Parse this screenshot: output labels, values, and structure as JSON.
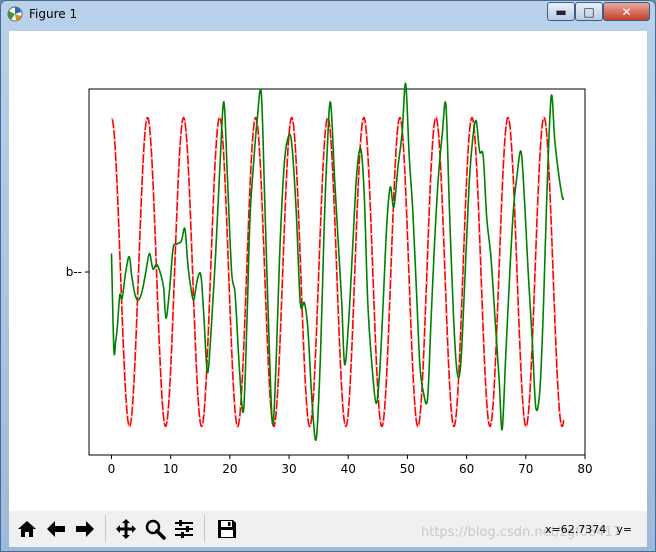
{
  "window": {
    "title": "Figure 1",
    "min_glyph": "▬",
    "max_glyph": "□",
    "close_glyph": "✕"
  },
  "toolbar": {
    "buttons": [
      {
        "name": "home",
        "icon": "home-icon"
      },
      {
        "name": "back",
        "icon": "arrow-left-icon"
      },
      {
        "name": "forward",
        "icon": "arrow-right-icon"
      },
      {
        "name": "pan",
        "icon": "move-icon"
      },
      {
        "name": "zoom",
        "icon": "magnifier-icon"
      },
      {
        "name": "subplots",
        "icon": "sliders-icon"
      },
      {
        "name": "save",
        "icon": "floppy-icon"
      }
    ],
    "coords_x": "x=62.7374",
    "coords_y": "y=",
    "watermark": "https://blog.csdn.net/zgf06417"
  },
  "chart_data": {
    "type": "line",
    "xlim": [
      -3.8,
      80
    ],
    "ylim": [
      -1.185,
      1.185
    ],
    "xticks": [
      0,
      10,
      20,
      30,
      40,
      50,
      60,
      70,
      80
    ],
    "ytick_label": "b--",
    "ytick_value": 0,
    "grid": false,
    "colors": {
      "sine": "#ff0000",
      "predicted": "#008000",
      "dashes": "#ffffff"
    },
    "series": [
      {
        "color": "red",
        "style": "cosine, dashed white overlay",
        "x_start": 0,
        "x_end": 76.4,
        "amplitude": 1.0,
        "period": 6.09
      },
      {
        "color": "green",
        "style": "solid",
        "points": [
          [
            0,
            0.12
          ],
          [
            0.4,
            -0.5
          ],
          [
            0.7,
            -0.45
          ],
          [
            1,
            -0.35
          ],
          [
            1.4,
            -0.15
          ],
          [
            1.8,
            -0.17
          ],
          [
            2.4,
            0.0
          ],
          [
            3,
            0.1
          ],
          [
            3.4,
            -0.02
          ],
          [
            4,
            -0.15
          ],
          [
            4.6,
            -0.18
          ],
          [
            5.2,
            -0.12
          ],
          [
            5.8,
            0.0
          ],
          [
            6.4,
            0.12
          ],
          [
            7,
            0.02
          ],
          [
            7.6,
            0.05
          ],
          [
            8.2,
            0.0
          ],
          [
            8.8,
            -0.1
          ],
          [
            9.2,
            -0.3
          ],
          [
            9.8,
            -0.12
          ],
          [
            10.4,
            0.15
          ],
          [
            11,
            0.18
          ],
          [
            11.8,
            0.2
          ],
          [
            12.4,
            0.28
          ],
          [
            12.9,
            0.05
          ],
          [
            13.4,
            -0.1
          ],
          [
            13.9,
            -0.18
          ],
          [
            14.5,
            -0.05
          ],
          [
            15.1,
            -0.02
          ],
          [
            15.6,
            -0.28
          ],
          [
            16.2,
            -0.65
          ],
          [
            16.8,
            -0.4
          ],
          [
            17.6,
            0.12
          ],
          [
            18.4,
            0.75
          ],
          [
            19,
            1.1
          ],
          [
            19.6,
            0.6
          ],
          [
            20.3,
            0.0
          ],
          [
            20.9,
            -0.15
          ],
          [
            21.6,
            -0.62
          ],
          [
            22.3,
            -0.9
          ],
          [
            22.9,
            -0.3
          ],
          [
            23.4,
            0.35
          ],
          [
            24,
            0.7
          ],
          [
            24.6,
            0.98
          ],
          [
            25.3,
            1.16
          ],
          [
            25.9,
            0.45
          ],
          [
            26.5,
            -0.3
          ],
          [
            27.2,
            -0.98
          ],
          [
            27.8,
            -0.6
          ],
          [
            28.4,
            0.1
          ],
          [
            29.1,
            0.65
          ],
          [
            29.7,
            0.85
          ],
          [
            30.4,
            0.85
          ],
          [
            31.2,
            0.4
          ],
          [
            31.9,
            -0.2
          ],
          [
            32.6,
            -0.2
          ],
          [
            33.2,
            -0.38
          ],
          [
            33.9,
            -0.85
          ],
          [
            34.6,
            -1.08
          ],
          [
            35.3,
            -0.55
          ],
          [
            35.9,
            0.25
          ],
          [
            36.4,
            0.75
          ],
          [
            37,
            1.1
          ],
          [
            37.7,
            0.6
          ],
          [
            38.3,
            0.2
          ],
          [
            38.9,
            -0.2
          ],
          [
            39.4,
            -0.6
          ],
          [
            40.1,
            -0.3
          ],
          [
            40.8,
            0.2
          ],
          [
            41.4,
            0.62
          ],
          [
            42.1,
            0.8
          ],
          [
            42.7,
            0.5
          ],
          [
            43.3,
            -0.2
          ],
          [
            44,
            -0.6
          ],
          [
            44.7,
            -0.85
          ],
          [
            45.3,
            -0.65
          ],
          [
            45.9,
            -0.2
          ],
          [
            46.5,
            0.3
          ],
          [
            47.1,
            0.55
          ],
          [
            47.7,
            0.42
          ],
          [
            48.4,
            0.68
          ],
          [
            49.1,
            0.9
          ],
          [
            49.7,
            1.22
          ],
          [
            50.3,
            0.75
          ],
          [
            50.9,
            0.4
          ],
          [
            51.5,
            -0.1
          ],
          [
            52.1,
            -0.6
          ],
          [
            52.7,
            -0.78
          ],
          [
            53.4,
            -0.82
          ],
          [
            54,
            -0.3
          ],
          [
            54.6,
            0.2
          ],
          [
            55.2,
            0.6
          ],
          [
            55.9,
            0.9
          ],
          [
            56.5,
            1.08
          ],
          [
            57.1,
            0.4
          ],
          [
            57.8,
            -0.3
          ],
          [
            58.4,
            -0.65
          ],
          [
            59,
            -0.6
          ],
          [
            59.7,
            -0.05
          ],
          [
            60.4,
            0.55
          ],
          [
            61,
            0.85
          ],
          [
            61.6,
            0.98
          ],
          [
            62.2,
            0.78
          ],
          [
            62.8,
            0.75
          ],
          [
            63.4,
            0.35
          ],
          [
            64.1,
            0.1
          ],
          [
            64.8,
            -0.3
          ],
          [
            65.5,
            -0.7
          ],
          [
            66,
            -1.02
          ],
          [
            66.6,
            -0.55
          ],
          [
            67.3,
            0.0
          ],
          [
            67.9,
            0.4
          ],
          [
            68.5,
            0.62
          ],
          [
            69.2,
            0.78
          ],
          [
            69.8,
            0.45
          ],
          [
            70.4,
            0.0
          ],
          [
            71.1,
            -0.45
          ],
          [
            71.7,
            -0.88
          ],
          [
            72.4,
            -0.75
          ],
          [
            73,
            -0.2
          ],
          [
            73.6,
            0.55
          ],
          [
            74.3,
            1.14
          ],
          [
            74.9,
            0.85
          ],
          [
            75.6,
            0.62
          ],
          [
            76.2,
            0.48
          ],
          [
            76.4,
            0.48
          ]
        ]
      }
    ]
  }
}
